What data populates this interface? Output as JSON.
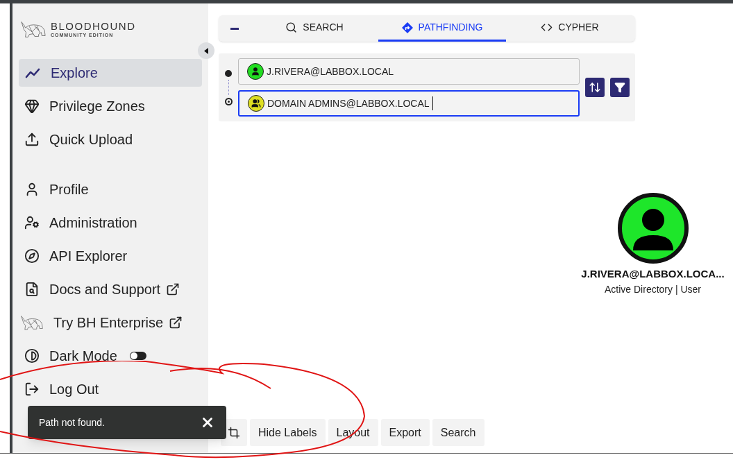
{
  "sidebar": {
    "logo": {
      "title": "BLOODHOUND",
      "subtitle": "COMMUNITY EDITION"
    },
    "primary_items": [
      {
        "label": "Explore",
        "selected": true
      },
      {
        "label": "Privilege Zones",
        "selected": false
      },
      {
        "label": "Quick Upload",
        "selected": false
      }
    ],
    "secondary_items": [
      {
        "kind": "link",
        "label": "Profile",
        "external": false
      },
      {
        "kind": "link",
        "label": "Administration",
        "external": false
      },
      {
        "kind": "link",
        "label": "API Explorer",
        "external": false
      },
      {
        "kind": "link",
        "label": "Docs and Support",
        "external": true
      },
      {
        "kind": "link",
        "label": "Try BH Enterprise",
        "external": true
      },
      {
        "kind": "toggle",
        "label": "Dark Mode",
        "on": false
      },
      {
        "kind": "link",
        "label": "Log Out",
        "external": false
      }
    ]
  },
  "tabs": [
    {
      "label": "SEARCH",
      "selected": false
    },
    {
      "label": "PATHFINDING",
      "selected": true
    },
    {
      "label": "CYPHER",
      "selected": false
    }
  ],
  "pathfinding": {
    "start": {
      "value": "J.RIVERA@LABBOX.LOCAL",
      "color": "#22dd22",
      "kind": "user",
      "focused": false
    },
    "end": {
      "value": "DOMAIN ADMINS@LABBOX.LOCAL",
      "color": "#dede22",
      "kind": "group",
      "focused": true
    }
  },
  "graph_node": {
    "label": "J.RIVERA@LABBOX.LOCA...",
    "sublabel": "Active Directory | User",
    "color": "#1ee62a"
  },
  "toolbar": [
    "Hide Labels",
    "Layout",
    "Export",
    "Search"
  ],
  "toast": {
    "message": "Path not found."
  }
}
